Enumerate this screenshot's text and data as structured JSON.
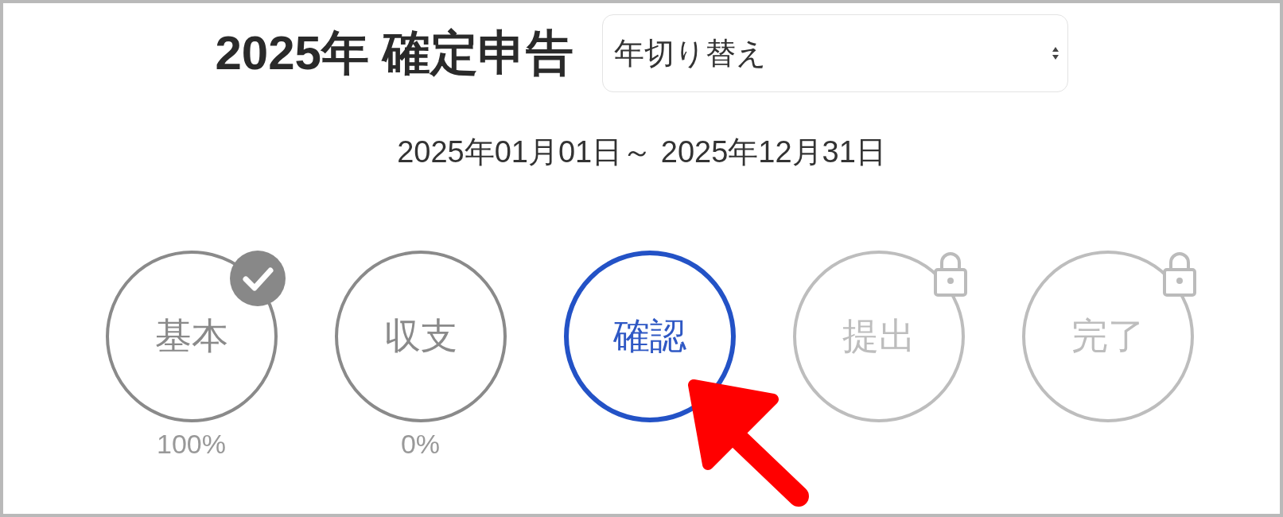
{
  "title": "2025年 確定申告",
  "year_select": {
    "value": "年切り替え"
  },
  "period": "2025年01月01日～ 2025年12月31日",
  "steps": [
    {
      "label": "基本",
      "kind": "done",
      "percent": "100%"
    },
    {
      "label": "収支",
      "kind": "todo",
      "percent": "0%"
    },
    {
      "label": "確認",
      "kind": "current"
    },
    {
      "label": "提出",
      "kind": "locked"
    },
    {
      "label": "完了",
      "kind": "locked"
    }
  ]
}
